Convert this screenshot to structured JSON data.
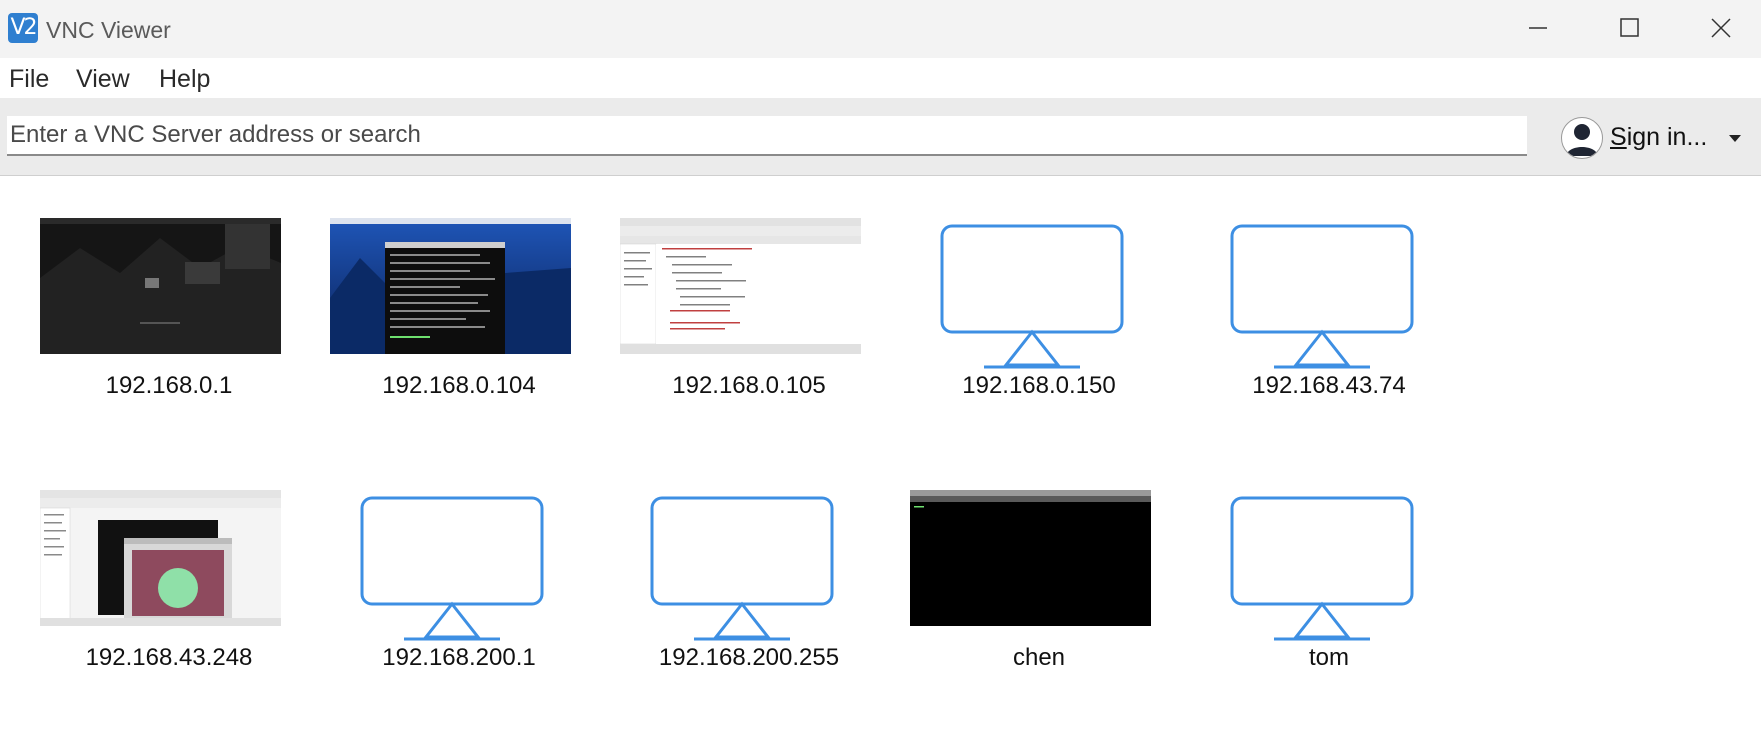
{
  "window": {
    "title": "VNC Viewer",
    "logo_text": "V2"
  },
  "menu": {
    "items": [
      "File",
      "View",
      "Help"
    ]
  },
  "search": {
    "placeholder": "Enter a VNC Server address or search"
  },
  "account": {
    "signin_first": "S",
    "signin_rest": "ign in..."
  },
  "colors": {
    "accent": "#3d8fe3",
    "toolbar_bg": "#ebebeb",
    "title_bg": "#f3f3f3"
  },
  "connections": [
    {
      "label": "192.168.0.1",
      "preview": "dark-desktop"
    },
    {
      "label": "192.168.0.104",
      "preview": "blue-desktop-terminal"
    },
    {
      "label": "192.168.0.105",
      "preview": "code-editor"
    },
    {
      "label": "192.168.0.150",
      "preview": "monitor-icon"
    },
    {
      "label": "192.168.43.74",
      "preview": "monitor-icon"
    },
    {
      "label": "192.168.43.248",
      "preview": "desktop-with-camera"
    },
    {
      "label": "192.168.200.1",
      "preview": "monitor-icon"
    },
    {
      "label": "192.168.200.255",
      "preview": "monitor-icon"
    },
    {
      "label": "chen",
      "preview": "black-terminal"
    },
    {
      "label": "tom",
      "preview": "monitor-icon"
    }
  ]
}
